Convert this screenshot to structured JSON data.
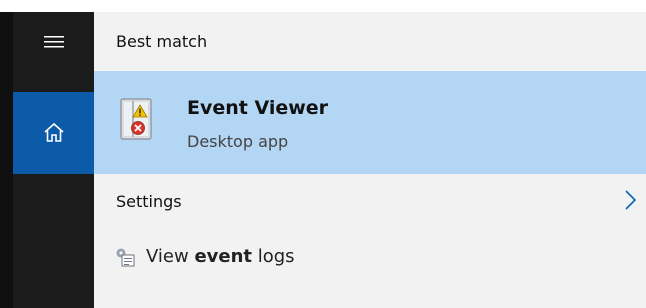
{
  "nav": {
    "menu_icon": "hamburger-icon",
    "home_icon": "home-icon",
    "accent": "#0c5ba8"
  },
  "results": {
    "best_match_header": "Best match",
    "best_match": {
      "title": "Event Viewer",
      "subtitle": "Desktop app",
      "icon": "event-viewer-icon",
      "highlight": "#b3d6f4"
    },
    "settings_header": "Settings",
    "settings_items": [
      {
        "text_before": "View ",
        "text_bold": "event",
        "text_after": " logs",
        "icon": "settings-log-icon"
      }
    ]
  }
}
